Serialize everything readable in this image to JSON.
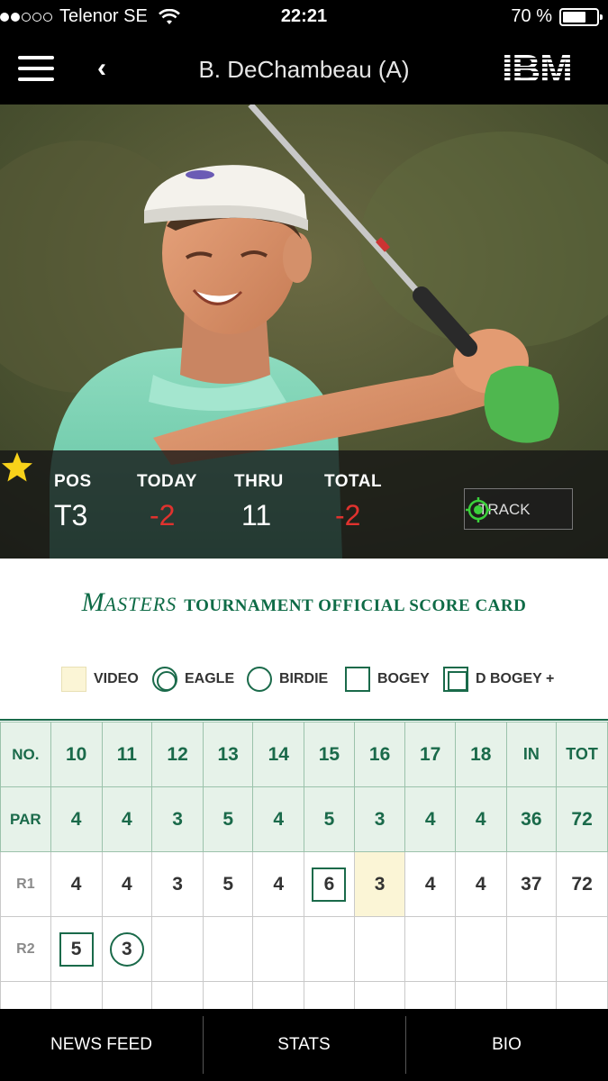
{
  "status_bar": {
    "carrier": "Telenor SE",
    "time": "22:21",
    "battery_text": "70 %",
    "battery_level": 0.7,
    "signal_bars_filled": 2,
    "signal_bars_total": 5
  },
  "nav": {
    "title": "B. DeChambeau (A)",
    "logo_text": "IBM"
  },
  "player_stats": {
    "pos_label": "POS",
    "pos_value": "T3",
    "today_label": "TODAY",
    "today_value": "-2",
    "thru_label": "THRU",
    "thru_value": "11",
    "total_label": "TOTAL",
    "total_value": "-2",
    "track_label": "TRACK",
    "favorited": true
  },
  "scorecard": {
    "title_m": "M",
    "title_asters": "ASTERS",
    "title_rest": "TOURNAMENT OFFICIAL SCORE CARD",
    "legend": {
      "video": "VIDEO",
      "eagle": "EAGLE",
      "birdie": "BIRDIE",
      "bogey": "BOGEY",
      "dbogey": "D BOGEY +"
    },
    "headers": [
      "NO.",
      "10",
      "11",
      "12",
      "13",
      "14",
      "15",
      "16",
      "17",
      "18",
      "IN",
      "TOT"
    ],
    "par": [
      "PAR",
      "4",
      "4",
      "3",
      "5",
      "4",
      "5",
      "3",
      "4",
      "4",
      "36",
      "72"
    ],
    "r1": [
      "R1",
      "4",
      "4",
      "3",
      "5",
      "4",
      "6",
      "3",
      "4",
      "4",
      "37",
      "72"
    ],
    "r2": [
      "R2",
      "5",
      "3",
      "",
      "",
      "",
      "",
      "",
      "",
      "",
      "",
      ""
    ]
  },
  "colors": {
    "masters_green": "#1a6a4a",
    "under_par_red": "#e0322e",
    "video_highlight": "#fbf5d6",
    "star": "#f7d21a",
    "target_green": "#3bd13b"
  },
  "tabs": [
    "NEWS FEED",
    "STATS",
    "BIO"
  ]
}
